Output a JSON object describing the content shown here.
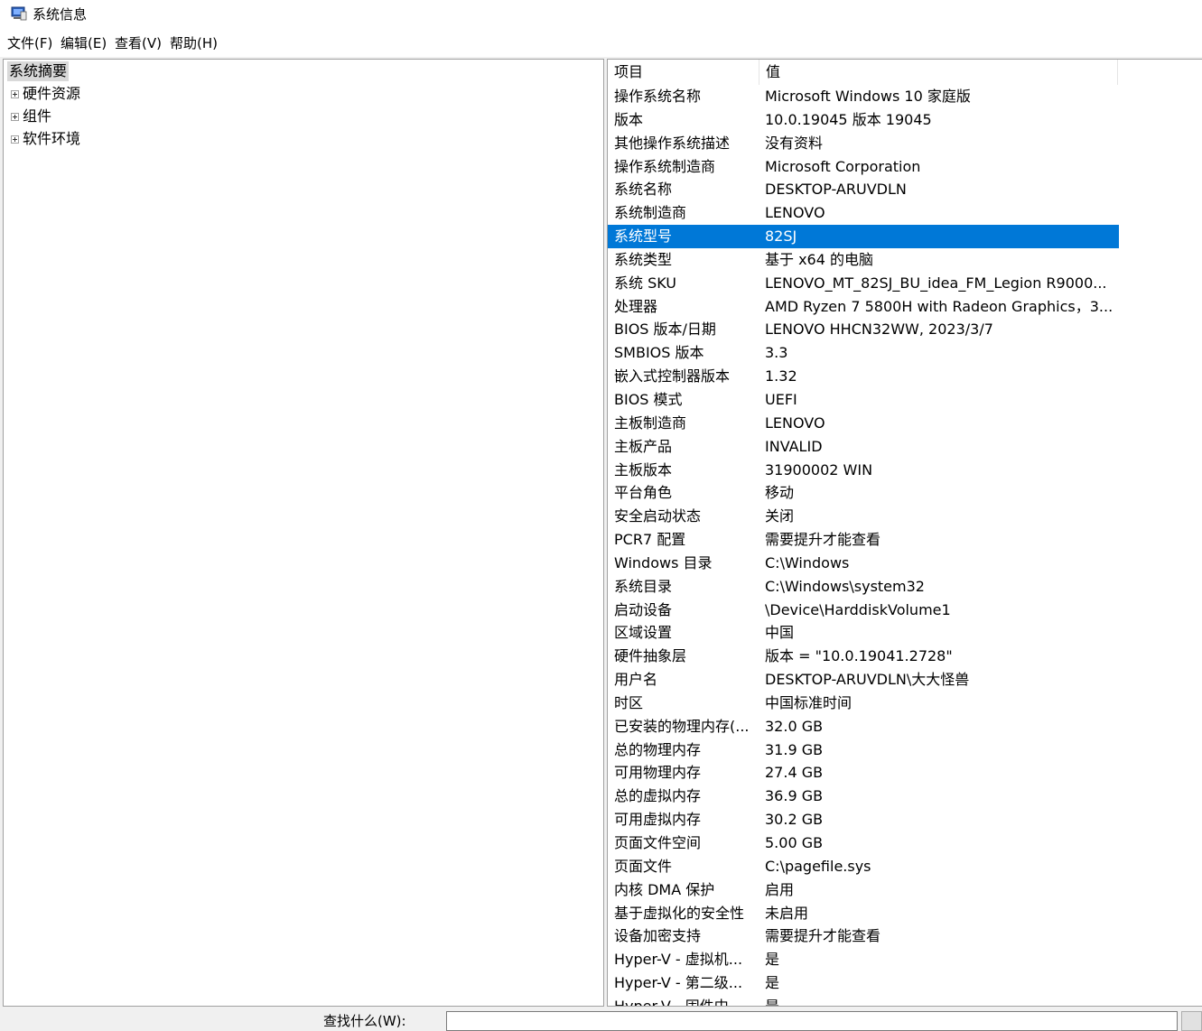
{
  "window": {
    "title": "系统信息",
    "icon": "system-info-icon"
  },
  "menu": {
    "file": "文件(F)",
    "edit": "编辑(E)",
    "view": "查看(V)",
    "help": "帮助(H)"
  },
  "tree": {
    "root": "系统摘要",
    "children": [
      "硬件资源",
      "组件",
      "软件环境"
    ]
  },
  "table": {
    "columns": [
      "项目",
      "值"
    ],
    "selected_index": 6,
    "rows": [
      [
        "操作系统名称",
        "Microsoft Windows 10 家庭版"
      ],
      [
        "版本",
        "10.0.19045 版本 19045"
      ],
      [
        "其他操作系统描述",
        "没有资料"
      ],
      [
        "操作系统制造商",
        "Microsoft Corporation"
      ],
      [
        "系统名称",
        "DESKTOP-ARUVDLN"
      ],
      [
        "系统制造商",
        "LENOVO"
      ],
      [
        "系统型号",
        "82SJ"
      ],
      [
        "系统类型",
        "基于 x64 的电脑"
      ],
      [
        "系统 SKU",
        "LENOVO_MT_82SJ_BU_idea_FM_Legion R9000..."
      ],
      [
        "处理器",
        "AMD Ryzen 7 5800H with Radeon Graphics，3..."
      ],
      [
        "BIOS 版本/日期",
        "LENOVO HHCN32WW, 2023/3/7"
      ],
      [
        "SMBIOS 版本",
        "3.3"
      ],
      [
        "嵌入式控制器版本",
        "1.32"
      ],
      [
        "BIOS 模式",
        "UEFI"
      ],
      [
        "主板制造商",
        "LENOVO"
      ],
      [
        "主板产品",
        "INVALID"
      ],
      [
        "主板版本",
        "31900002 WIN"
      ],
      [
        "平台角色",
        "移动"
      ],
      [
        "安全启动状态",
        "关闭"
      ],
      [
        "PCR7 配置",
        "需要提升才能查看"
      ],
      [
        "Windows 目录",
        "C:\\Windows"
      ],
      [
        "系统目录",
        "C:\\Windows\\system32"
      ],
      [
        "启动设备",
        "\\Device\\HarddiskVolume1"
      ],
      [
        "区域设置",
        "中国"
      ],
      [
        "硬件抽象层",
        "版本 = \"10.0.19041.2728\""
      ],
      [
        "用户名",
        "DESKTOP-ARUVDLN\\大大怪兽"
      ],
      [
        "时区",
        "中国标准时间"
      ],
      [
        "已安装的物理内存(...",
        "32.0 GB"
      ],
      [
        "总的物理内存",
        "31.9 GB"
      ],
      [
        "可用物理内存",
        "27.4 GB"
      ],
      [
        "总的虚拟内存",
        "36.9 GB"
      ],
      [
        "可用虚拟内存",
        "30.2 GB"
      ],
      [
        "页面文件空间",
        "5.00 GB"
      ],
      [
        "页面文件",
        "C:\\pagefile.sys"
      ],
      [
        "内核 DMA 保护",
        "启用"
      ],
      [
        "基于虚拟化的安全性",
        "未启用"
      ],
      [
        "设备加密支持",
        "需要提升才能查看"
      ],
      [
        "Hyper-V - 虚拟机...",
        "是"
      ],
      [
        "Hyper-V - 第二级...",
        "是"
      ],
      [
        "Hyper-V - 固件中...",
        "是"
      ]
    ]
  },
  "search": {
    "label": "查找什么(W):",
    "value": ""
  },
  "colors": {
    "selection": "#0078d7",
    "tree_root_highlight": "#d9d9d9"
  }
}
